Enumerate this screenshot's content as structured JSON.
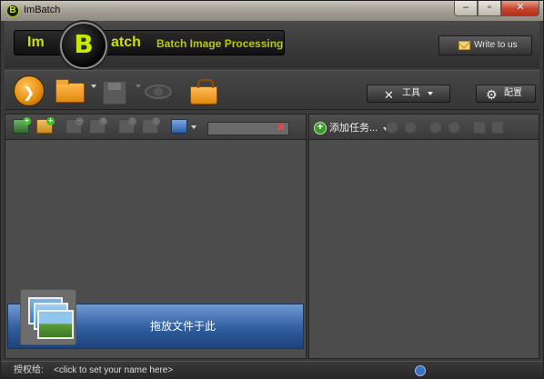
{
  "window": {
    "title": "ImBatch",
    "app_icon_letter": "B"
  },
  "header": {
    "logo_im": "Im",
    "logo_b": "B",
    "logo_atch": "atch",
    "logo_subtitle": "Batch Image Processing",
    "write_label": "Write to us"
  },
  "toolbar": {
    "tools_label": "工具",
    "config_label": "配置"
  },
  "right_panel": {
    "add_task_label": "添加任务..."
  },
  "left_panel": {
    "search_value": "",
    "drop_label": "拖放文件于此"
  },
  "statusbar": {
    "auth_label": "授权给:",
    "auth_link": "<click to set your name here>",
    "right_text": ""
  },
  "colors": {
    "accent_green": "#c9ea00",
    "orange": "#e48a07",
    "drop_blue": "#2f5d9e"
  }
}
